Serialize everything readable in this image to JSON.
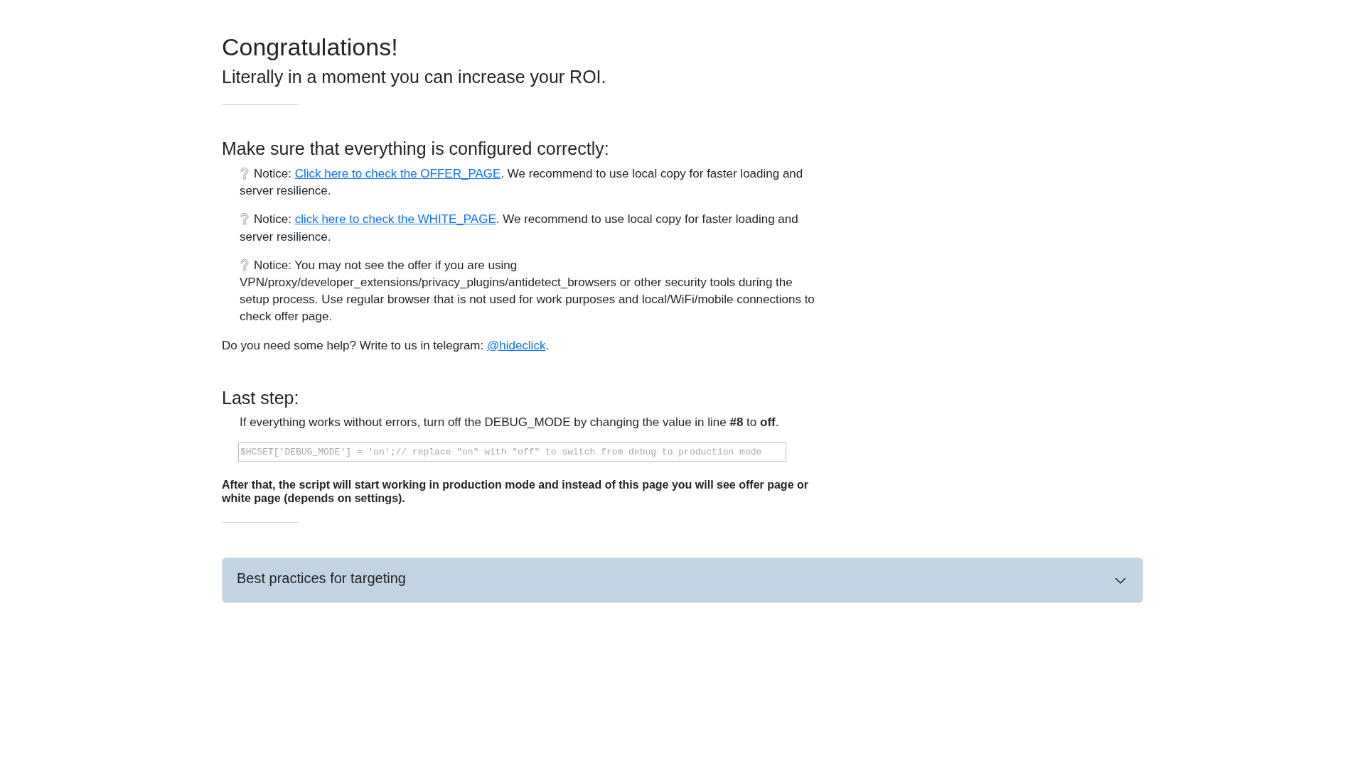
{
  "intro": {
    "title": "Congratulations!",
    "subtitle": "Literally in a moment you can increase your ROI."
  },
  "checklist": {
    "heading": "Make sure that everything is configured correctly:",
    "notices": [
      {
        "parts": [
          {
            "kind": "text",
            "text": "Notice: "
          },
          {
            "kind": "link",
            "text": "Click here to check the OFFER_PAGE"
          },
          {
            "kind": "text",
            "text": ". We recommend to use local copy for faster loading and server resilience."
          }
        ]
      },
      {
        "parts": [
          {
            "kind": "text",
            "text": "Notice: "
          },
          {
            "kind": "link",
            "text": "click here to check the WHITE_PAGE"
          },
          {
            "kind": "text",
            "text": ". We recommend to use local copy for faster loading and server resilience."
          }
        ]
      },
      {
        "parts": [
          {
            "kind": "text",
            "text": "Notice: You may not see the offer if you are using VPN/proxy/developer_extensions/privacy_plugins/antidetect_browsers or other security tools during the setup process. Use regular browser that is not used for work purposes and local/WiFi/mobile connections to check offer page."
          }
        ]
      }
    ],
    "help": {
      "parts": [
        {
          "kind": "text",
          "text": "Do you need some help? Write to us in telegram: "
        },
        {
          "kind": "link",
          "text": "@hideclick"
        },
        {
          "kind": "text",
          "text": "."
        }
      ]
    }
  },
  "last_step": {
    "heading": "Last step:",
    "instruction": "If everything works without errors, turn off the DEBUG_MODE by changing the value in line **#8** to **off**.",
    "code_line": "$HCSET['DEBUG_MODE'] = 'on';// replace \"on\" with \"off\" to switch from debug to production mode",
    "note": "After that, the script will start working in production mode and instead of this page you will see offer page or white page (depends on settings)."
  },
  "accordion": {
    "title": "Best practices for targeting",
    "expanded": false
  }
}
